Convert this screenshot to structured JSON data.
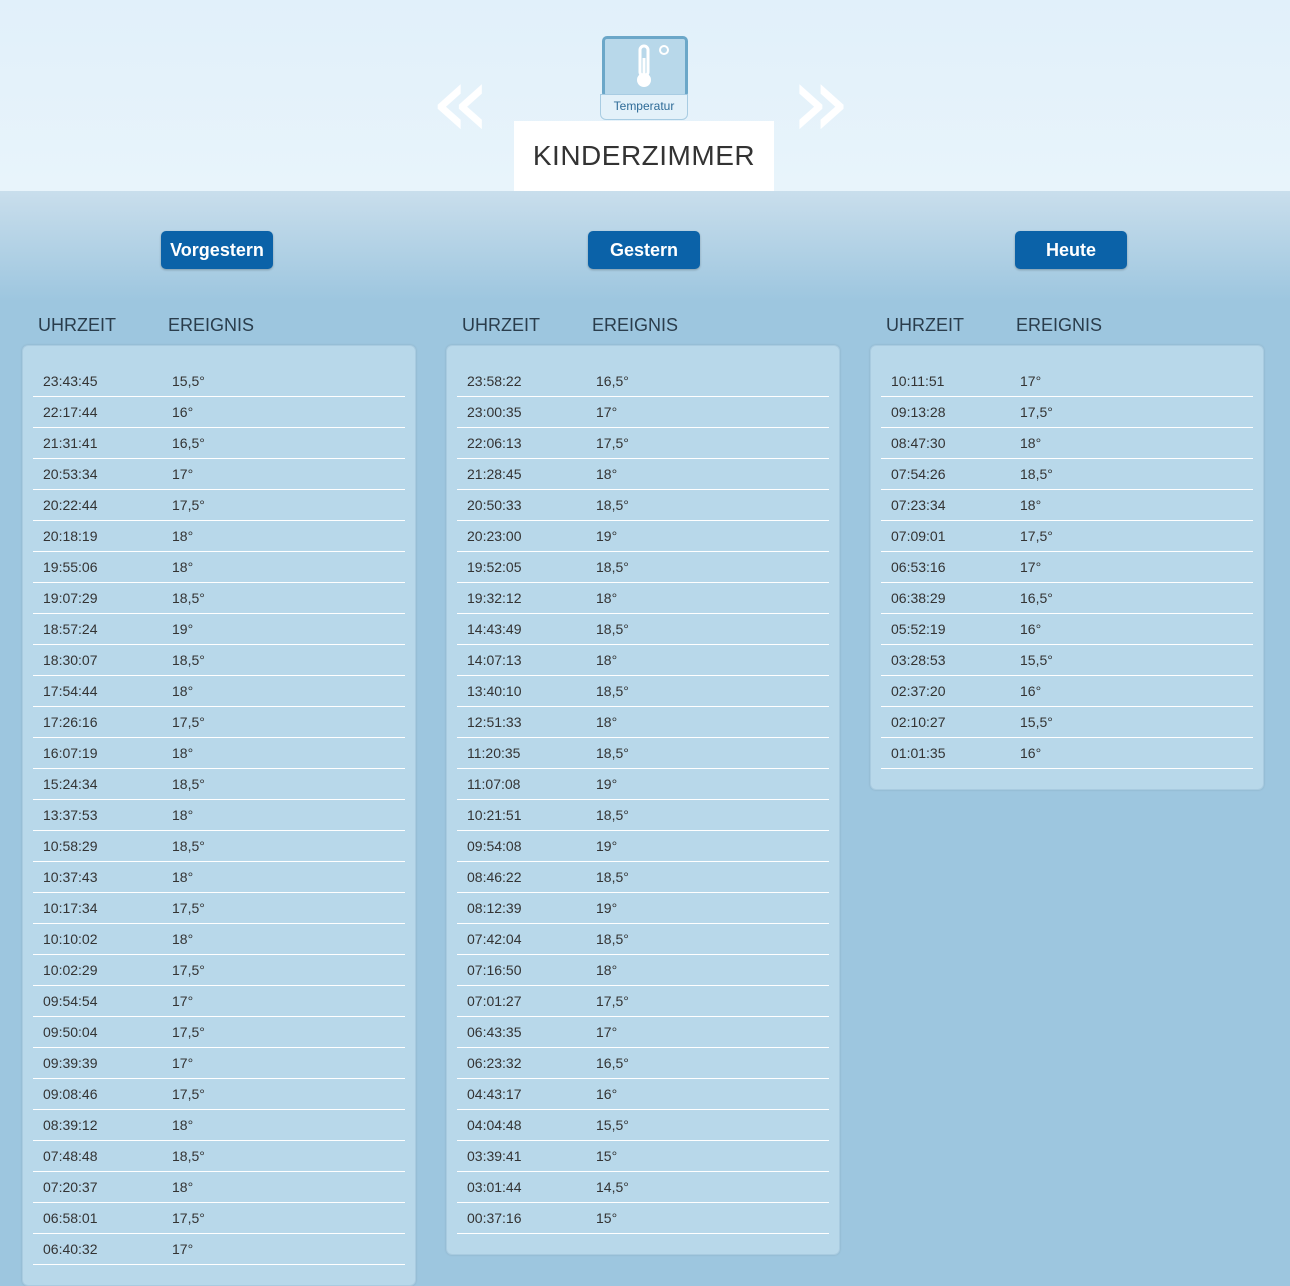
{
  "device": {
    "label": "Temperatur",
    "icon": "thermometer-icon",
    "room": "KINDERZIMMER"
  },
  "nav": {
    "prev": "«",
    "next": "»"
  },
  "columns_header": {
    "time": "UHRZEIT",
    "event": "EREIGNIS"
  },
  "days": [
    {
      "label": "Vorgestern",
      "rows": [
        {
          "time": "23:43:45",
          "value": "15,5°"
        },
        {
          "time": "22:17:44",
          "value": "16°"
        },
        {
          "time": "21:31:41",
          "value": "16,5°"
        },
        {
          "time": "20:53:34",
          "value": "17°"
        },
        {
          "time": "20:22:44",
          "value": "17,5°"
        },
        {
          "time": "20:18:19",
          "value": "18°"
        },
        {
          "time": "19:55:06",
          "value": "18°"
        },
        {
          "time": "19:07:29",
          "value": "18,5°"
        },
        {
          "time": "18:57:24",
          "value": "19°"
        },
        {
          "time": "18:30:07",
          "value": "18,5°"
        },
        {
          "time": "17:54:44",
          "value": "18°"
        },
        {
          "time": "17:26:16",
          "value": "17,5°"
        },
        {
          "time": "16:07:19",
          "value": "18°"
        },
        {
          "time": "15:24:34",
          "value": "18,5°"
        },
        {
          "time": "13:37:53",
          "value": "18°"
        },
        {
          "time": "10:58:29",
          "value": "18,5°"
        },
        {
          "time": "10:37:43",
          "value": "18°"
        },
        {
          "time": "10:17:34",
          "value": "17,5°"
        },
        {
          "time": "10:10:02",
          "value": "18°"
        },
        {
          "time": "10:02:29",
          "value": "17,5°"
        },
        {
          "time": "09:54:54",
          "value": "17°"
        },
        {
          "time": "09:50:04",
          "value": "17,5°"
        },
        {
          "time": "09:39:39",
          "value": "17°"
        },
        {
          "time": "09:08:46",
          "value": "17,5°"
        },
        {
          "time": "08:39:12",
          "value": "18°"
        },
        {
          "time": "07:48:48",
          "value": "18,5°"
        },
        {
          "time": "07:20:37",
          "value": "18°"
        },
        {
          "time": "06:58:01",
          "value": "17,5°"
        },
        {
          "time": "06:40:32",
          "value": "17°"
        }
      ]
    },
    {
      "label": "Gestern",
      "rows": [
        {
          "time": "23:58:22",
          "value": "16,5°"
        },
        {
          "time": "23:00:35",
          "value": "17°"
        },
        {
          "time": "22:06:13",
          "value": "17,5°"
        },
        {
          "time": "21:28:45",
          "value": "18°"
        },
        {
          "time": "20:50:33",
          "value": "18,5°"
        },
        {
          "time": "20:23:00",
          "value": "19°"
        },
        {
          "time": "19:52:05",
          "value": "18,5°"
        },
        {
          "time": "19:32:12",
          "value": "18°"
        },
        {
          "time": "14:43:49",
          "value": "18,5°"
        },
        {
          "time": "14:07:13",
          "value": "18°"
        },
        {
          "time": "13:40:10",
          "value": "18,5°"
        },
        {
          "time": "12:51:33",
          "value": "18°"
        },
        {
          "time": "11:20:35",
          "value": "18,5°"
        },
        {
          "time": "11:07:08",
          "value": "19°"
        },
        {
          "time": "10:21:51",
          "value": "18,5°"
        },
        {
          "time": "09:54:08",
          "value": "19°"
        },
        {
          "time": "08:46:22",
          "value": "18,5°"
        },
        {
          "time": "08:12:39",
          "value": "19°"
        },
        {
          "time": "07:42:04",
          "value": "18,5°"
        },
        {
          "time": "07:16:50",
          "value": "18°"
        },
        {
          "time": "07:01:27",
          "value": "17,5°"
        },
        {
          "time": "06:43:35",
          "value": "17°"
        },
        {
          "time": "06:23:32",
          "value": "16,5°"
        },
        {
          "time": "04:43:17",
          "value": "16°"
        },
        {
          "time": "04:04:48",
          "value": "15,5°"
        },
        {
          "time": "03:39:41",
          "value": "15°"
        },
        {
          "time": "03:01:44",
          "value": "14,5°"
        },
        {
          "time": "00:37:16",
          "value": "15°"
        }
      ]
    },
    {
      "label": "Heute",
      "rows": [
        {
          "time": "10:11:51",
          "value": "17°"
        },
        {
          "time": "09:13:28",
          "value": "17,5°"
        },
        {
          "time": "08:47:30",
          "value": "18°"
        },
        {
          "time": "07:54:26",
          "value": "18,5°"
        },
        {
          "time": "07:23:34",
          "value": "18°"
        },
        {
          "time": "07:09:01",
          "value": "17,5°"
        },
        {
          "time": "06:53:16",
          "value": "17°"
        },
        {
          "time": "06:38:29",
          "value": "16,5°"
        },
        {
          "time": "05:52:19",
          "value": "16°"
        },
        {
          "time": "03:28:53",
          "value": "15,5°"
        },
        {
          "time": "02:37:20",
          "value": "16°"
        },
        {
          "time": "02:10:27",
          "value": "15,5°"
        },
        {
          "time": "01:01:35",
          "value": "16°"
        }
      ]
    }
  ]
}
